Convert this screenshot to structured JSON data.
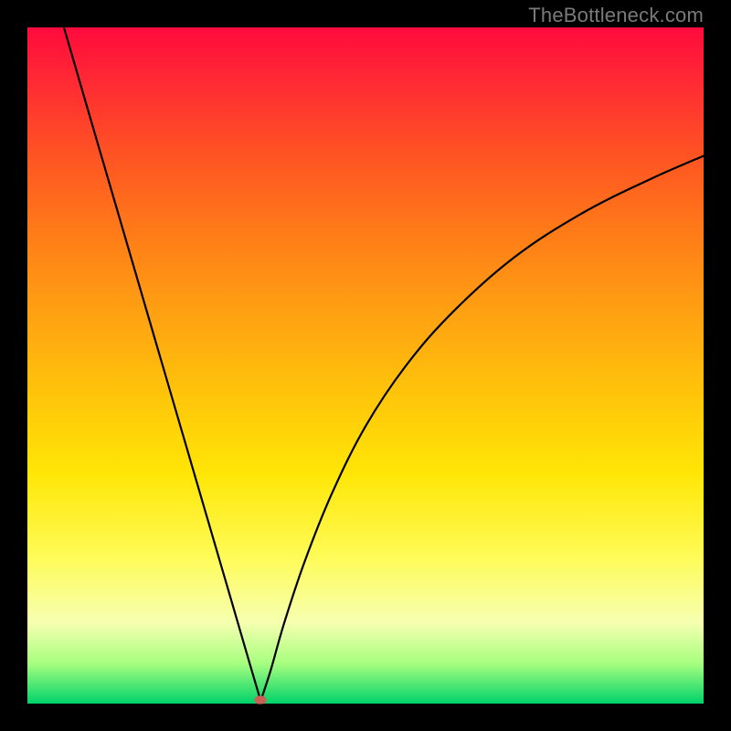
{
  "watermark": "TheBottleneck.com",
  "chart_data": {
    "type": "line",
    "title": "",
    "xlabel": "",
    "ylabel": "",
    "xlim": [
      0,
      100
    ],
    "ylim": [
      0,
      100
    ],
    "curve_left": {
      "x": [
        5.4,
        10,
        15,
        20,
        25,
        30,
        33,
        34.5
      ],
      "y": [
        100,
        84.2,
        67.1,
        50.0,
        32.9,
        15.8,
        5.5,
        0.4
      ]
    },
    "curve_right": {
      "x": [
        34.5,
        36,
        38,
        41,
        45,
        50,
        56,
        63,
        72,
        82,
        92,
        100
      ],
      "y": [
        0.4,
        5,
        12,
        21,
        31,
        41,
        50,
        58,
        66,
        72.5,
        77.5,
        81
      ]
    },
    "marker": {
      "x": 34.5,
      "y": 0.6
    },
    "colors": {
      "gradient_top": "#ff0a3c",
      "gradient_bottom": "#00d26a",
      "curve": "#000000",
      "marker": "#cc6055",
      "frame": "#000000"
    }
  }
}
